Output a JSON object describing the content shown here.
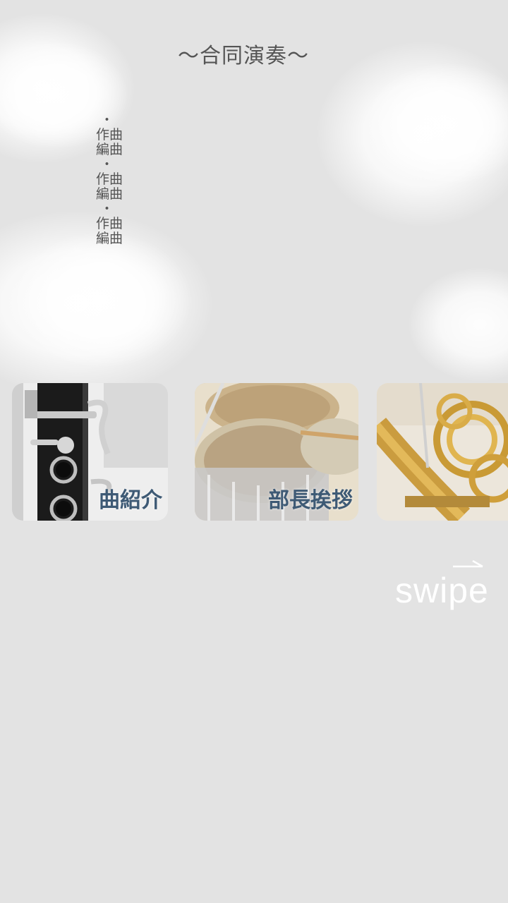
{
  "header": {
    "title": "〜合同演奏〜"
  },
  "credits": {
    "entries": [
      {
        "dot": "・",
        "line1": "作曲",
        "line2": "編曲"
      },
      {
        "dot": "・",
        "line1": "作曲",
        "line2": "編曲"
      },
      {
        "dot": "・",
        "line1": "作曲",
        "line2": "編曲"
      }
    ]
  },
  "cards": [
    {
      "label": "曲紹介",
      "image": "clarinet-photo"
    },
    {
      "label": "部長挨拶",
      "image": "drums-photo"
    },
    {
      "label": "",
      "image": "french-horn-photo"
    }
  ],
  "swipe_hint": {
    "label": "swipe",
    "icon": "right-arrow-icon"
  },
  "colors": {
    "background": "#e3e3e3",
    "card_label": "#3e5a75",
    "title_text": "#555555",
    "swipe_text": "#ffffff"
  }
}
